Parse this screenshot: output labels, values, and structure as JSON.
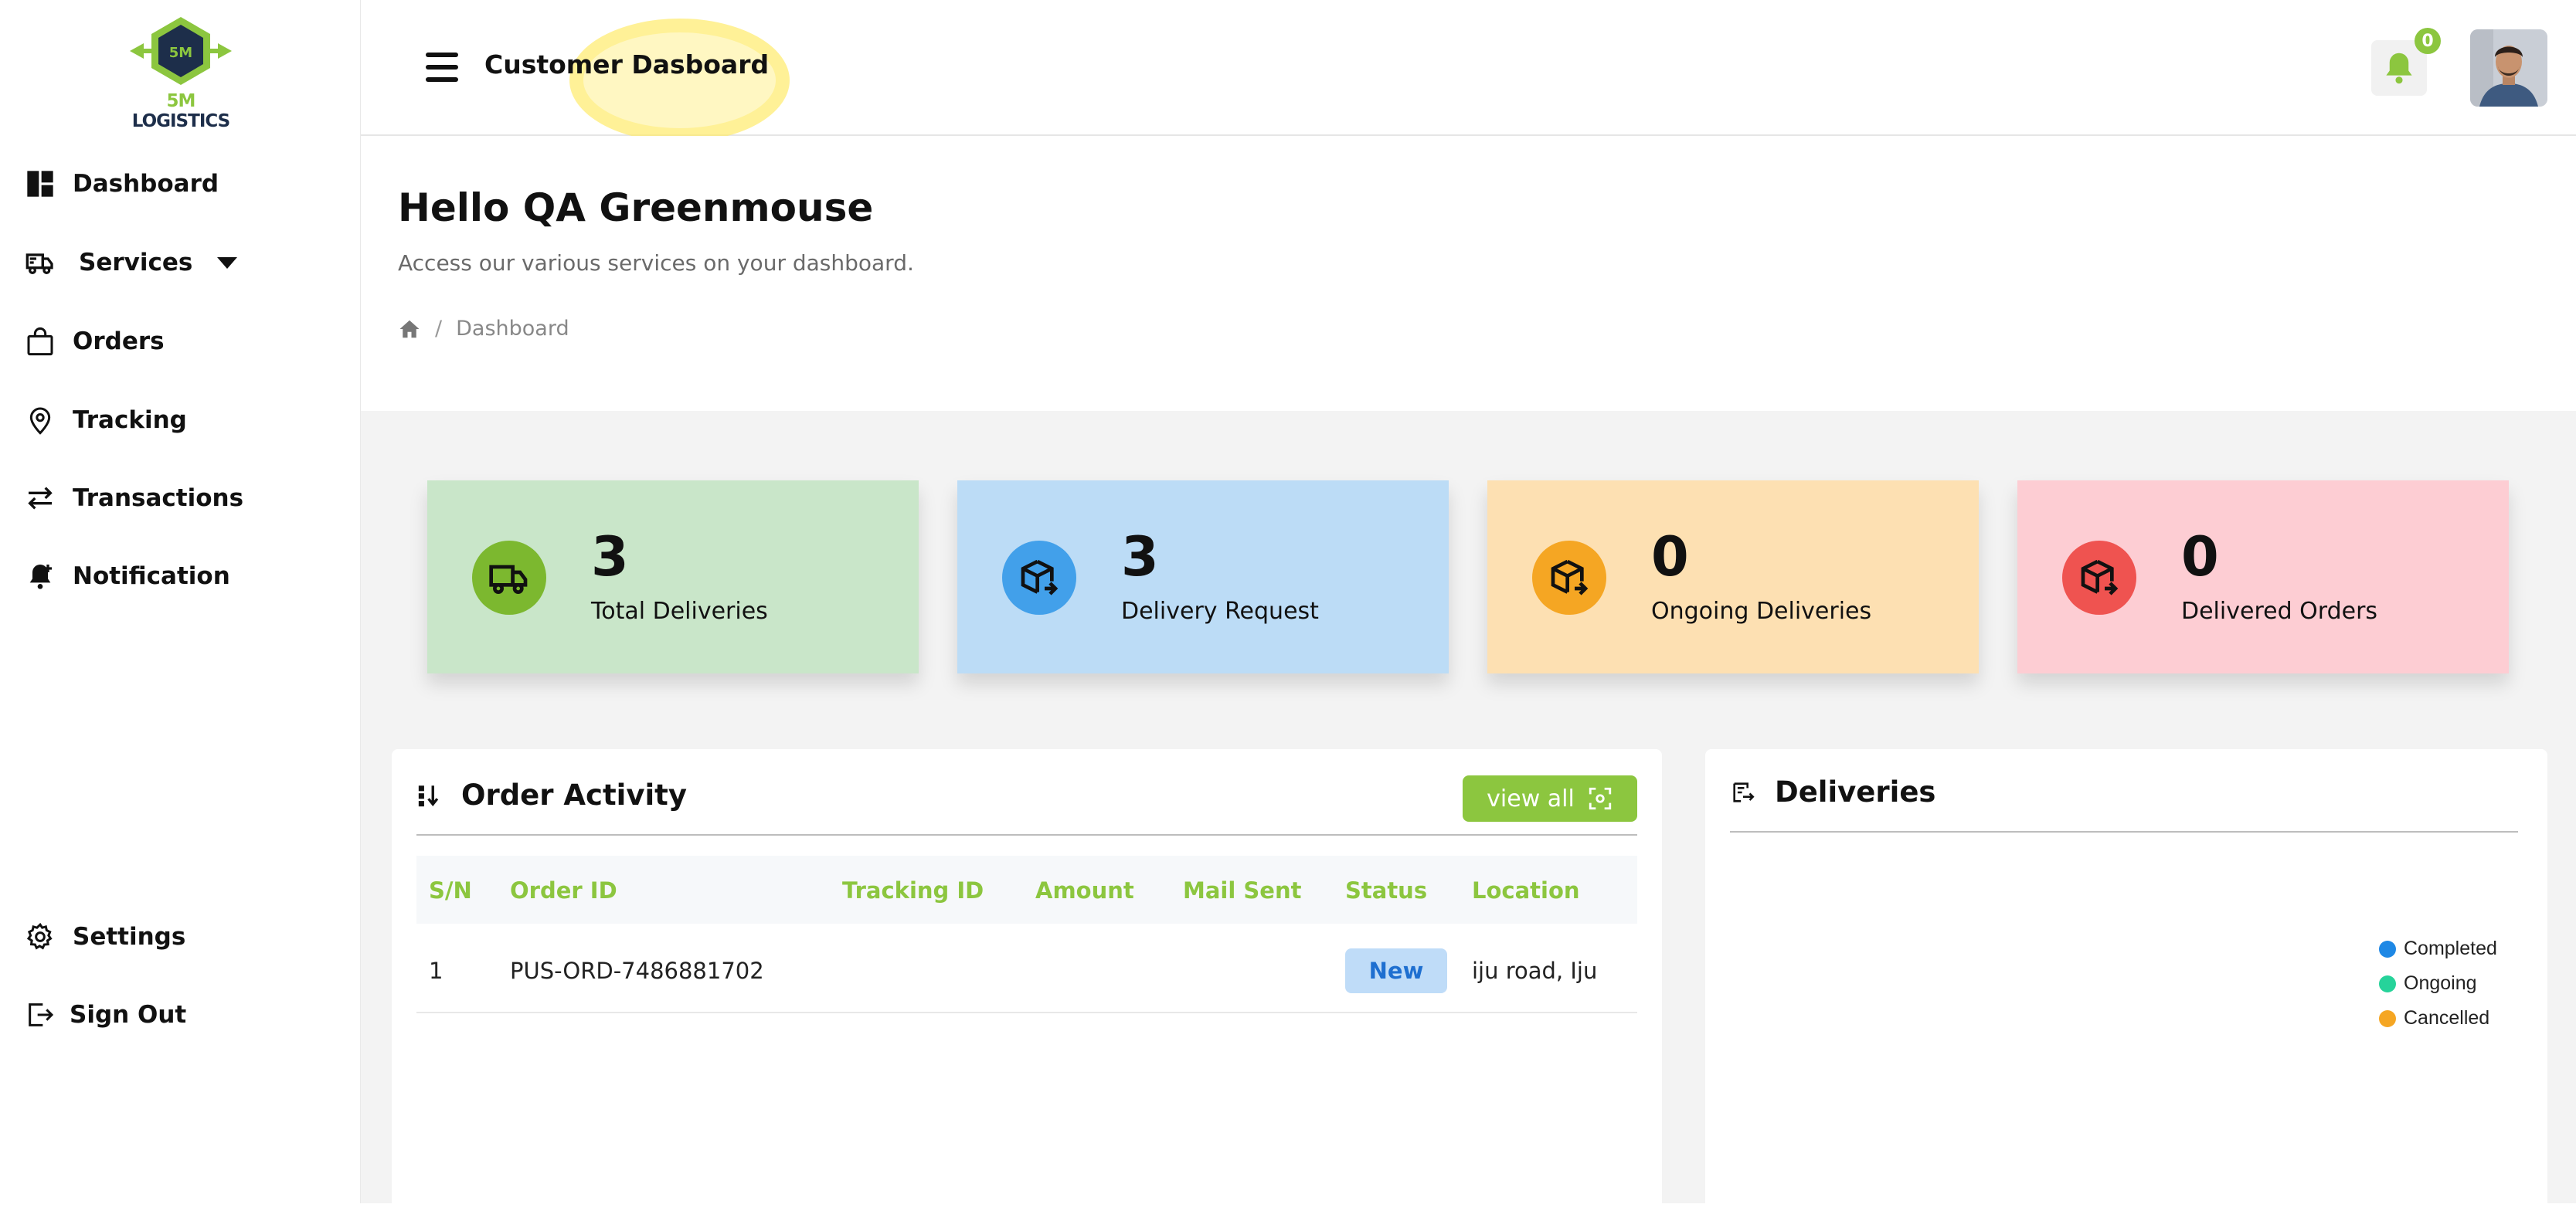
{
  "brand": {
    "logo_top": "5M",
    "logo_word1": "5M",
    "logo_word2": "LOGISTICS"
  },
  "sidebar": {
    "items": [
      {
        "label": "Dashboard",
        "icon": "dashboard-icon"
      },
      {
        "label": "Services",
        "icon": "delivery-truck-icon"
      },
      {
        "label": "Orders",
        "icon": "shopping-bag-icon"
      },
      {
        "label": "Tracking",
        "icon": "location-pin-icon"
      },
      {
        "label": "Transactions",
        "icon": "arrows-swap-icon"
      },
      {
        "label": "Notification",
        "icon": "bell-plus-icon"
      }
    ],
    "bottom": [
      {
        "label": "Settings",
        "icon": "gear-icon"
      },
      {
        "label": "Sign Out",
        "icon": "sign-out-icon"
      }
    ]
  },
  "header": {
    "title": "Customer Dasboard",
    "notification_count": "0"
  },
  "hero": {
    "greeting": "Hello QA Greenmouse",
    "subtitle": "Access our various services on your dashboard.",
    "breadcrumb_current": "Dashboard",
    "breadcrumb_sep": "/"
  },
  "stats": [
    {
      "value": "3",
      "label": "Total Deliveries",
      "bg": "#c9e6c9",
      "accent": "#7cb82f"
    },
    {
      "value": "3",
      "label": "Delivery Request",
      "bg": "#bcdcf6",
      "accent": "#42a0ea"
    },
    {
      "value": "0",
      "label": "Ongoing Deliveries",
      "bg": "#fde0b2",
      "accent": "#f5a623"
    },
    {
      "value": "0",
      "label": "Delivered Orders",
      "bg": "#fdcdd3",
      "accent": "#ef5350"
    }
  ],
  "order_activity": {
    "title": "Order Activity",
    "view_all": "view all",
    "columns": [
      "S/N",
      "Order ID",
      "Tracking ID",
      "Amount",
      "Mail Sent",
      "Status",
      "Location"
    ],
    "rows": [
      {
        "sn": "1",
        "order_id": "PUS-ORD-7486881702",
        "tracking_id": "",
        "amount": "",
        "mail_sent": "",
        "status": "New",
        "location": "iju road, Iju"
      }
    ]
  },
  "deliveries": {
    "title": "Deliveries",
    "legend": [
      {
        "label": "Completed",
        "color": "#1e88e5"
      },
      {
        "label": "Ongoing",
        "color": "#26d39a"
      },
      {
        "label": "Cancelled",
        "color": "#f5a623"
      }
    ]
  }
}
